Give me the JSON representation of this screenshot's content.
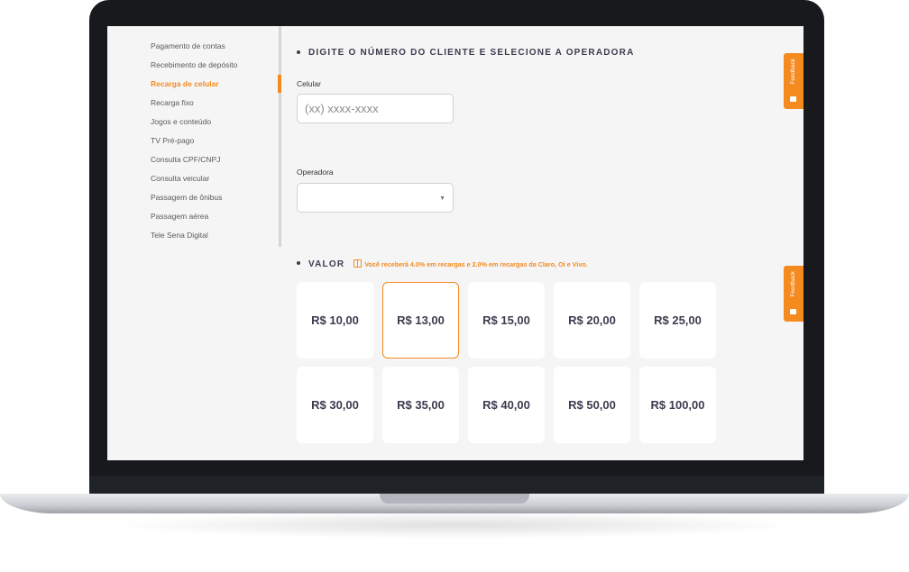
{
  "sidebar": {
    "items": [
      {
        "label": "Pagamento de contas"
      },
      {
        "label": "Recebimento de depósito"
      },
      {
        "label": "Recarga de celular"
      },
      {
        "label": "Recarga fixo"
      },
      {
        "label": "Jogos e conteúdo"
      },
      {
        "label": "TV Pré-pago"
      },
      {
        "label": "Consulta CPF/CNPJ"
      },
      {
        "label": "Consulta veicular"
      },
      {
        "label": "Passagem de ônibus"
      },
      {
        "label": "Passagem aérea"
      },
      {
        "label": "Tele Sena Digital"
      }
    ],
    "active_item": "Recarga de celular"
  },
  "form": {
    "section_title": "DIGITE O NÚMERO DO CLIENTE E SELECIONE A OPERADORA",
    "celular_label": "Celular",
    "celular_placeholder": "(xx) xxxx-xxxx",
    "operadora_label": "Operadora",
    "operadora_value": ""
  },
  "valor": {
    "title": "VALOR",
    "note": "Você receberá 4.0% em recargas e 2.0% em recargas da Claro, Oi e Vivo.",
    "options": [
      {
        "label": "R$ 10,00"
      },
      {
        "label": "R$ 13,00"
      },
      {
        "label": "R$ 15,00"
      },
      {
        "label": "R$ 20,00"
      },
      {
        "label": "R$ 25,00"
      },
      {
        "label": "R$ 30,00"
      },
      {
        "label": "R$ 35,00"
      },
      {
        "label": "R$ 40,00"
      },
      {
        "label": "R$ 50,00"
      },
      {
        "label": "R$ 100,00"
      }
    ],
    "selected": "R$ 13,00"
  },
  "feedback": {
    "label": "Feedback"
  },
  "colors": {
    "accent": "#f58a1f",
    "text": "#3c3c50",
    "background": "#f5f5f5"
  }
}
